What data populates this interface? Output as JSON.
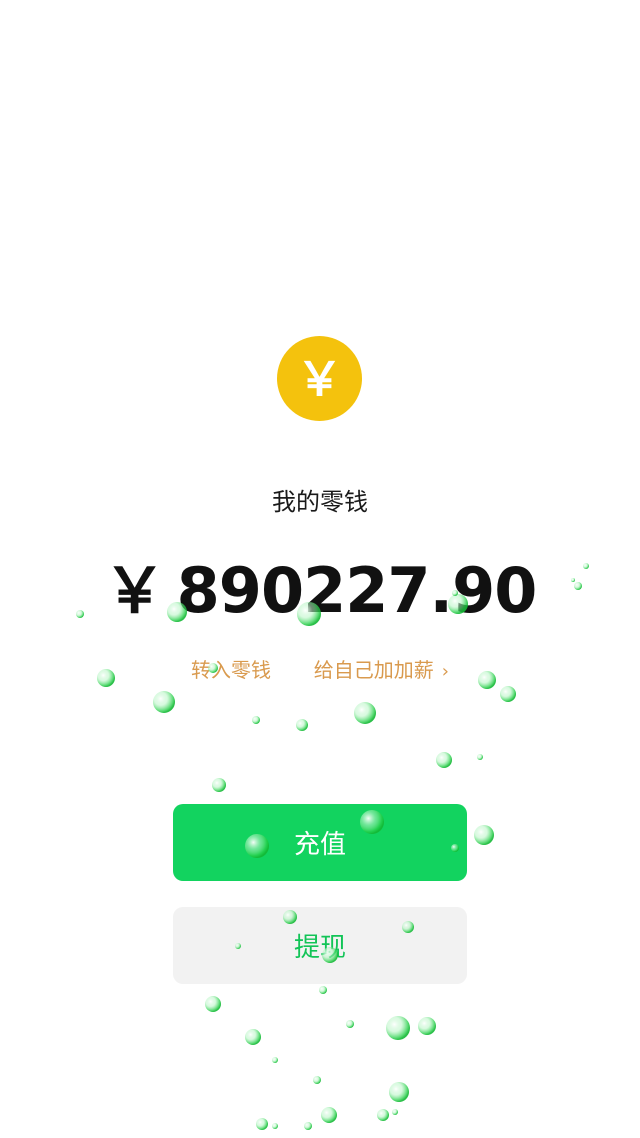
{
  "coin": {
    "symbol": "￥",
    "icon": "yuan-coin-icon",
    "color": "#f4c20d"
  },
  "wallet": {
    "title": "我的零钱",
    "currency": "￥",
    "amount": "890227.90"
  },
  "links": {
    "transfer_in": "转入零钱",
    "bonus": "给自己加加薪",
    "chevron": "›"
  },
  "buttons": {
    "recharge": "充值",
    "withdraw": "提现"
  },
  "colors": {
    "primary_green": "#12d35f",
    "link_orange": "#d99a4e",
    "secondary_bg": "#f2f2f2"
  }
}
